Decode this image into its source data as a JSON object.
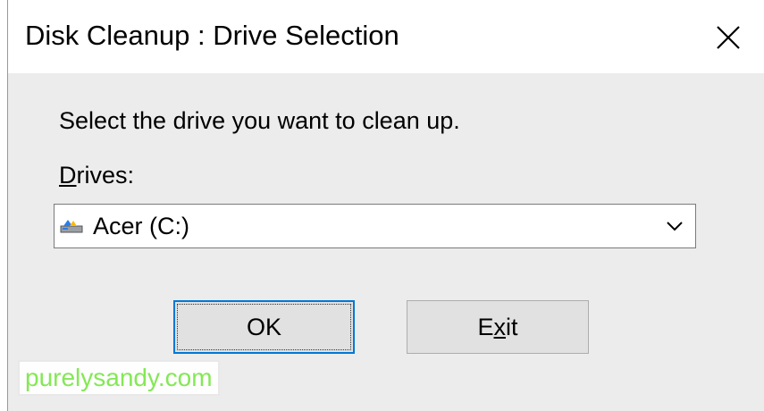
{
  "window": {
    "title": "Disk Cleanup : Drive Selection",
    "close_icon": "close-icon"
  },
  "content": {
    "prompt": "Select the drive you want to clean up.",
    "drives_label_accel": "D",
    "drives_label_rest": "rives:",
    "drive_select": {
      "selected_value": "Acer (C:)",
      "icon": "drive-icon"
    }
  },
  "buttons": {
    "ok_label": "OK",
    "exit_accel": "x",
    "exit_before": "E",
    "exit_after": "it"
  },
  "watermark": "purelysandy.com",
  "colors": {
    "focus_border": "#0078d7",
    "dialog_bg": "#ececec",
    "watermark_text": "#7fe84f"
  }
}
